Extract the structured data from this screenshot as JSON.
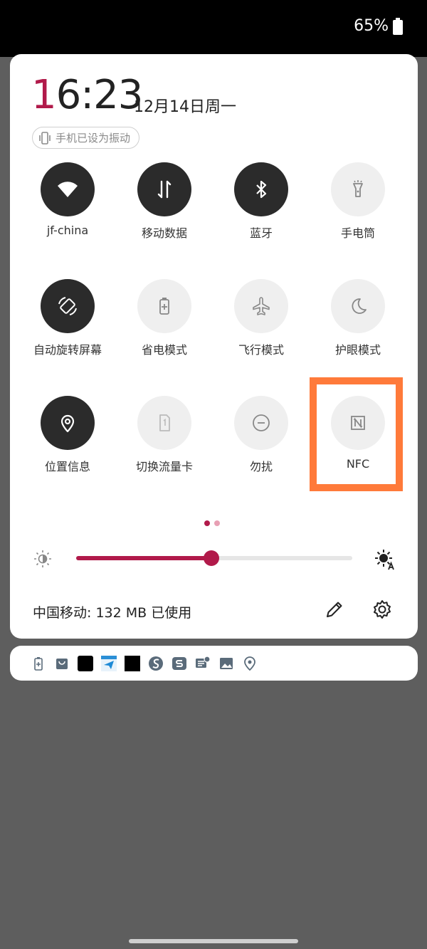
{
  "status_bar": {
    "battery": "65%"
  },
  "header": {
    "time_first": "1",
    "time_rest": "6:23",
    "date": "12月14日周一",
    "ringer_chip": "手机已设为振动"
  },
  "tiles": [
    {
      "label": "jf-china",
      "icon": "wifi-icon",
      "active": true
    },
    {
      "label": "移动数据",
      "icon": "mobile-data-icon",
      "active": true
    },
    {
      "label": "蓝牙",
      "icon": "bluetooth-icon",
      "active": true
    },
    {
      "label": "手电筒",
      "icon": "flashlight-icon",
      "active": false
    },
    {
      "label": "自动旋转屏幕",
      "icon": "auto-rotate-icon",
      "active": true
    },
    {
      "label": "省电模式",
      "icon": "battery-saver-icon",
      "active": false
    },
    {
      "label": "飞行模式",
      "icon": "airplane-icon",
      "active": false
    },
    {
      "label": "护眼模式",
      "icon": "moon-icon",
      "active": false
    },
    {
      "label": "位置信息",
      "icon": "location-icon",
      "active": true
    },
    {
      "label": "切换流量卡",
      "icon": "sim-card-icon",
      "active": false
    },
    {
      "label": "勿扰",
      "icon": "do-not-disturb-icon",
      "active": false
    },
    {
      "label": "NFC",
      "icon": "nfc-icon",
      "active": false,
      "highlighted": true
    }
  ],
  "page_indicator": {
    "pages": 2,
    "current": 1,
    "active_color": "#b11a4a",
    "inactive_color": "#e8a0b4"
  },
  "brightness": {
    "level": 0.49,
    "accent": "#b11a4a"
  },
  "footer": {
    "data_usage": "中国移动: 132 MB 已使用"
  },
  "notifications": {
    "icons": [
      "battery-charge-icon",
      "shopping-bag-icon",
      "app-icon-black",
      "app-icon-12306",
      "app-icon-black-2",
      "sogou-icon",
      "s-app-icon",
      "message-icon",
      "image-icon",
      "location-pin-icon"
    ]
  },
  "colors": {
    "highlight": "#ff7a3a",
    "tile_on": "#2b2b2b",
    "tile_off": "#efefef"
  }
}
